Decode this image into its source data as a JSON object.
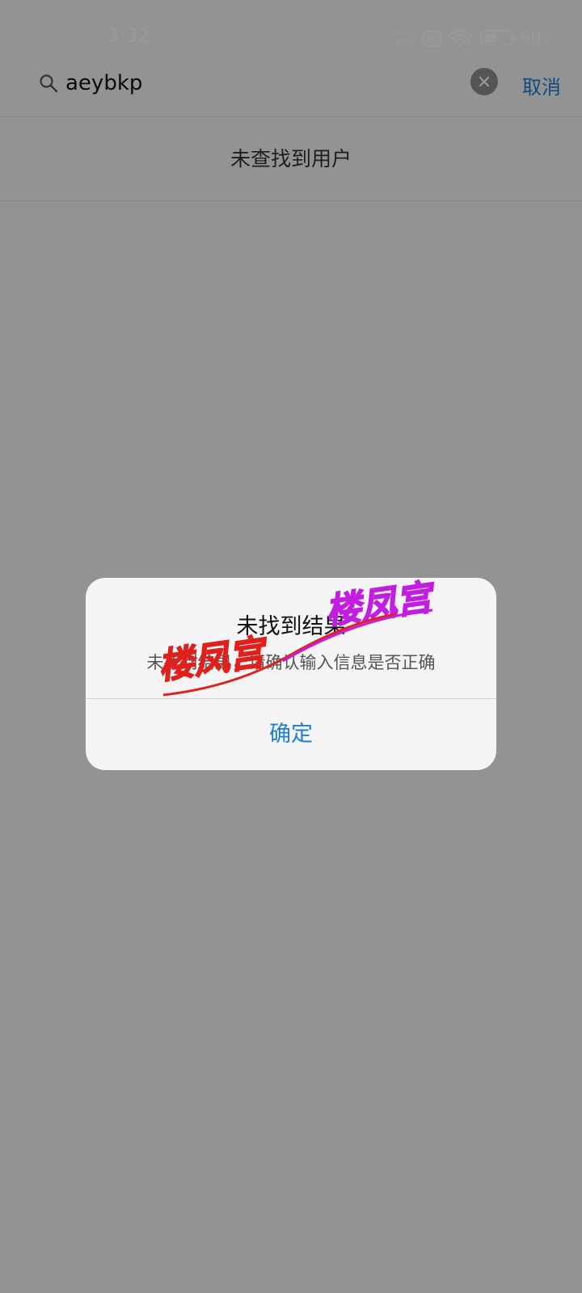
{
  "status_bar": {
    "time": "3:32",
    "net_speed_value": "0.11",
    "net_speed_unit": "KB/s",
    "wifi_badge": "6",
    "battery_percent": "50",
    "battery_unit": "%",
    "battery_level": 0.5,
    "icons": [
      "no-sim-icon",
      "wifi-icon",
      "battery-icon"
    ]
  },
  "search": {
    "query": "aeybkp",
    "cancel_label": "取消",
    "icons": [
      "search-icon",
      "clear-icon"
    ]
  },
  "results": {
    "empty_message": "未查找到用户"
  },
  "dialog": {
    "title": "未找到结果",
    "message": "未找到结果，请确认输入信息是否正确",
    "confirm_label": "确定"
  },
  "watermark": {
    "text": "楼凤宫",
    "colors": [
      "#e0201c",
      "#c21ee0"
    ]
  },
  "colors": {
    "accent": "#1b7fd2",
    "dialog_background": "#f4f4f4",
    "page_background": "#f5f5f5"
  }
}
